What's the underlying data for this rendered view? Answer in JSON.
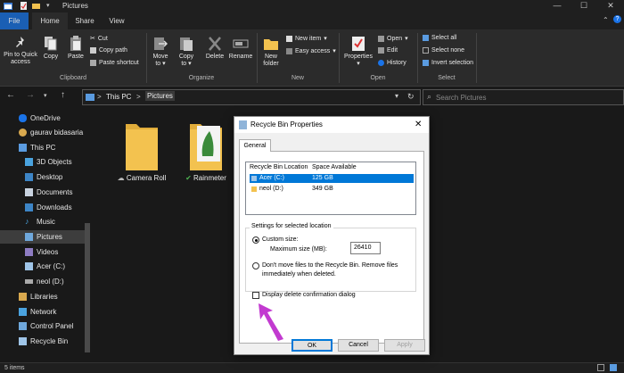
{
  "window": {
    "title": "Pictures"
  },
  "tabs": {
    "file": "File",
    "home": "Home",
    "share": "Share",
    "view": "View"
  },
  "ribbon": {
    "clipboard": {
      "pin_line1": "Pin to Quick",
      "pin_line2": "access",
      "copy": "Copy",
      "paste": "Paste",
      "cut": "Cut",
      "copy_path": "Copy path",
      "paste_shortcut": "Paste shortcut",
      "label": "Clipboard"
    },
    "organize": {
      "move_line1": "Move",
      "move_line2": "to",
      "copy_line1": "Copy",
      "copy_line2": "to",
      "delete": "Delete",
      "rename": "Rename",
      "label": "Organize"
    },
    "new": {
      "folder_line1": "New",
      "folder_line2": "folder",
      "new_item": "New item",
      "easy_access": "Easy access",
      "label": "New"
    },
    "open": {
      "properties": "Properties",
      "open": "Open",
      "edit": "Edit",
      "history": "History",
      "label": "Open"
    },
    "select": {
      "all": "Select all",
      "none": "Select none",
      "invert": "Invert selection",
      "label": "Select"
    }
  },
  "address": {
    "this_pc": "This PC",
    "pictures": "Pictures",
    "separator": ">",
    "search_placeholder": "Search Pictures"
  },
  "nav_items": [
    "OneDrive",
    "gaurav bidasaria",
    "This PC",
    "3D Objects",
    "Desktop",
    "Documents",
    "Downloads",
    "Music",
    "Pictures",
    "Videos",
    "Acer (C:)",
    "neol (D:)",
    "Libraries",
    "Network",
    "Control Panel",
    "Recycle Bin"
  ],
  "folders": [
    {
      "name": "Camera Roll"
    },
    {
      "name": "Rainmeter"
    }
  ],
  "status": {
    "count": "5 items"
  },
  "dialog": {
    "title": "Recycle Bin Properties",
    "tab": "General",
    "col_location": "Recycle Bin Location",
    "col_space": "Space Available",
    "rows": [
      {
        "location": "Acer (C:)",
        "space": "125 GB"
      },
      {
        "location": "neol (D:)",
        "space": "349 GB"
      }
    ],
    "settings_label": "Settings for selected location",
    "custom_size": "Custom size:",
    "max_size_label": "Maximum size (MB):",
    "max_size_value": "26410",
    "dont_move_line1": "Don't move files to the Recycle Bin. Remove files",
    "dont_move_line2": "immediately when deleted.",
    "display_confirm": "Display delete confirmation dialog",
    "ok": "OK",
    "cancel": "Cancel",
    "apply": "Apply"
  },
  "colors": {
    "accent": "#1a5fb4",
    "arrow": "#c23ad0",
    "folder": "#f3c24f",
    "selection": "#0078d7"
  }
}
